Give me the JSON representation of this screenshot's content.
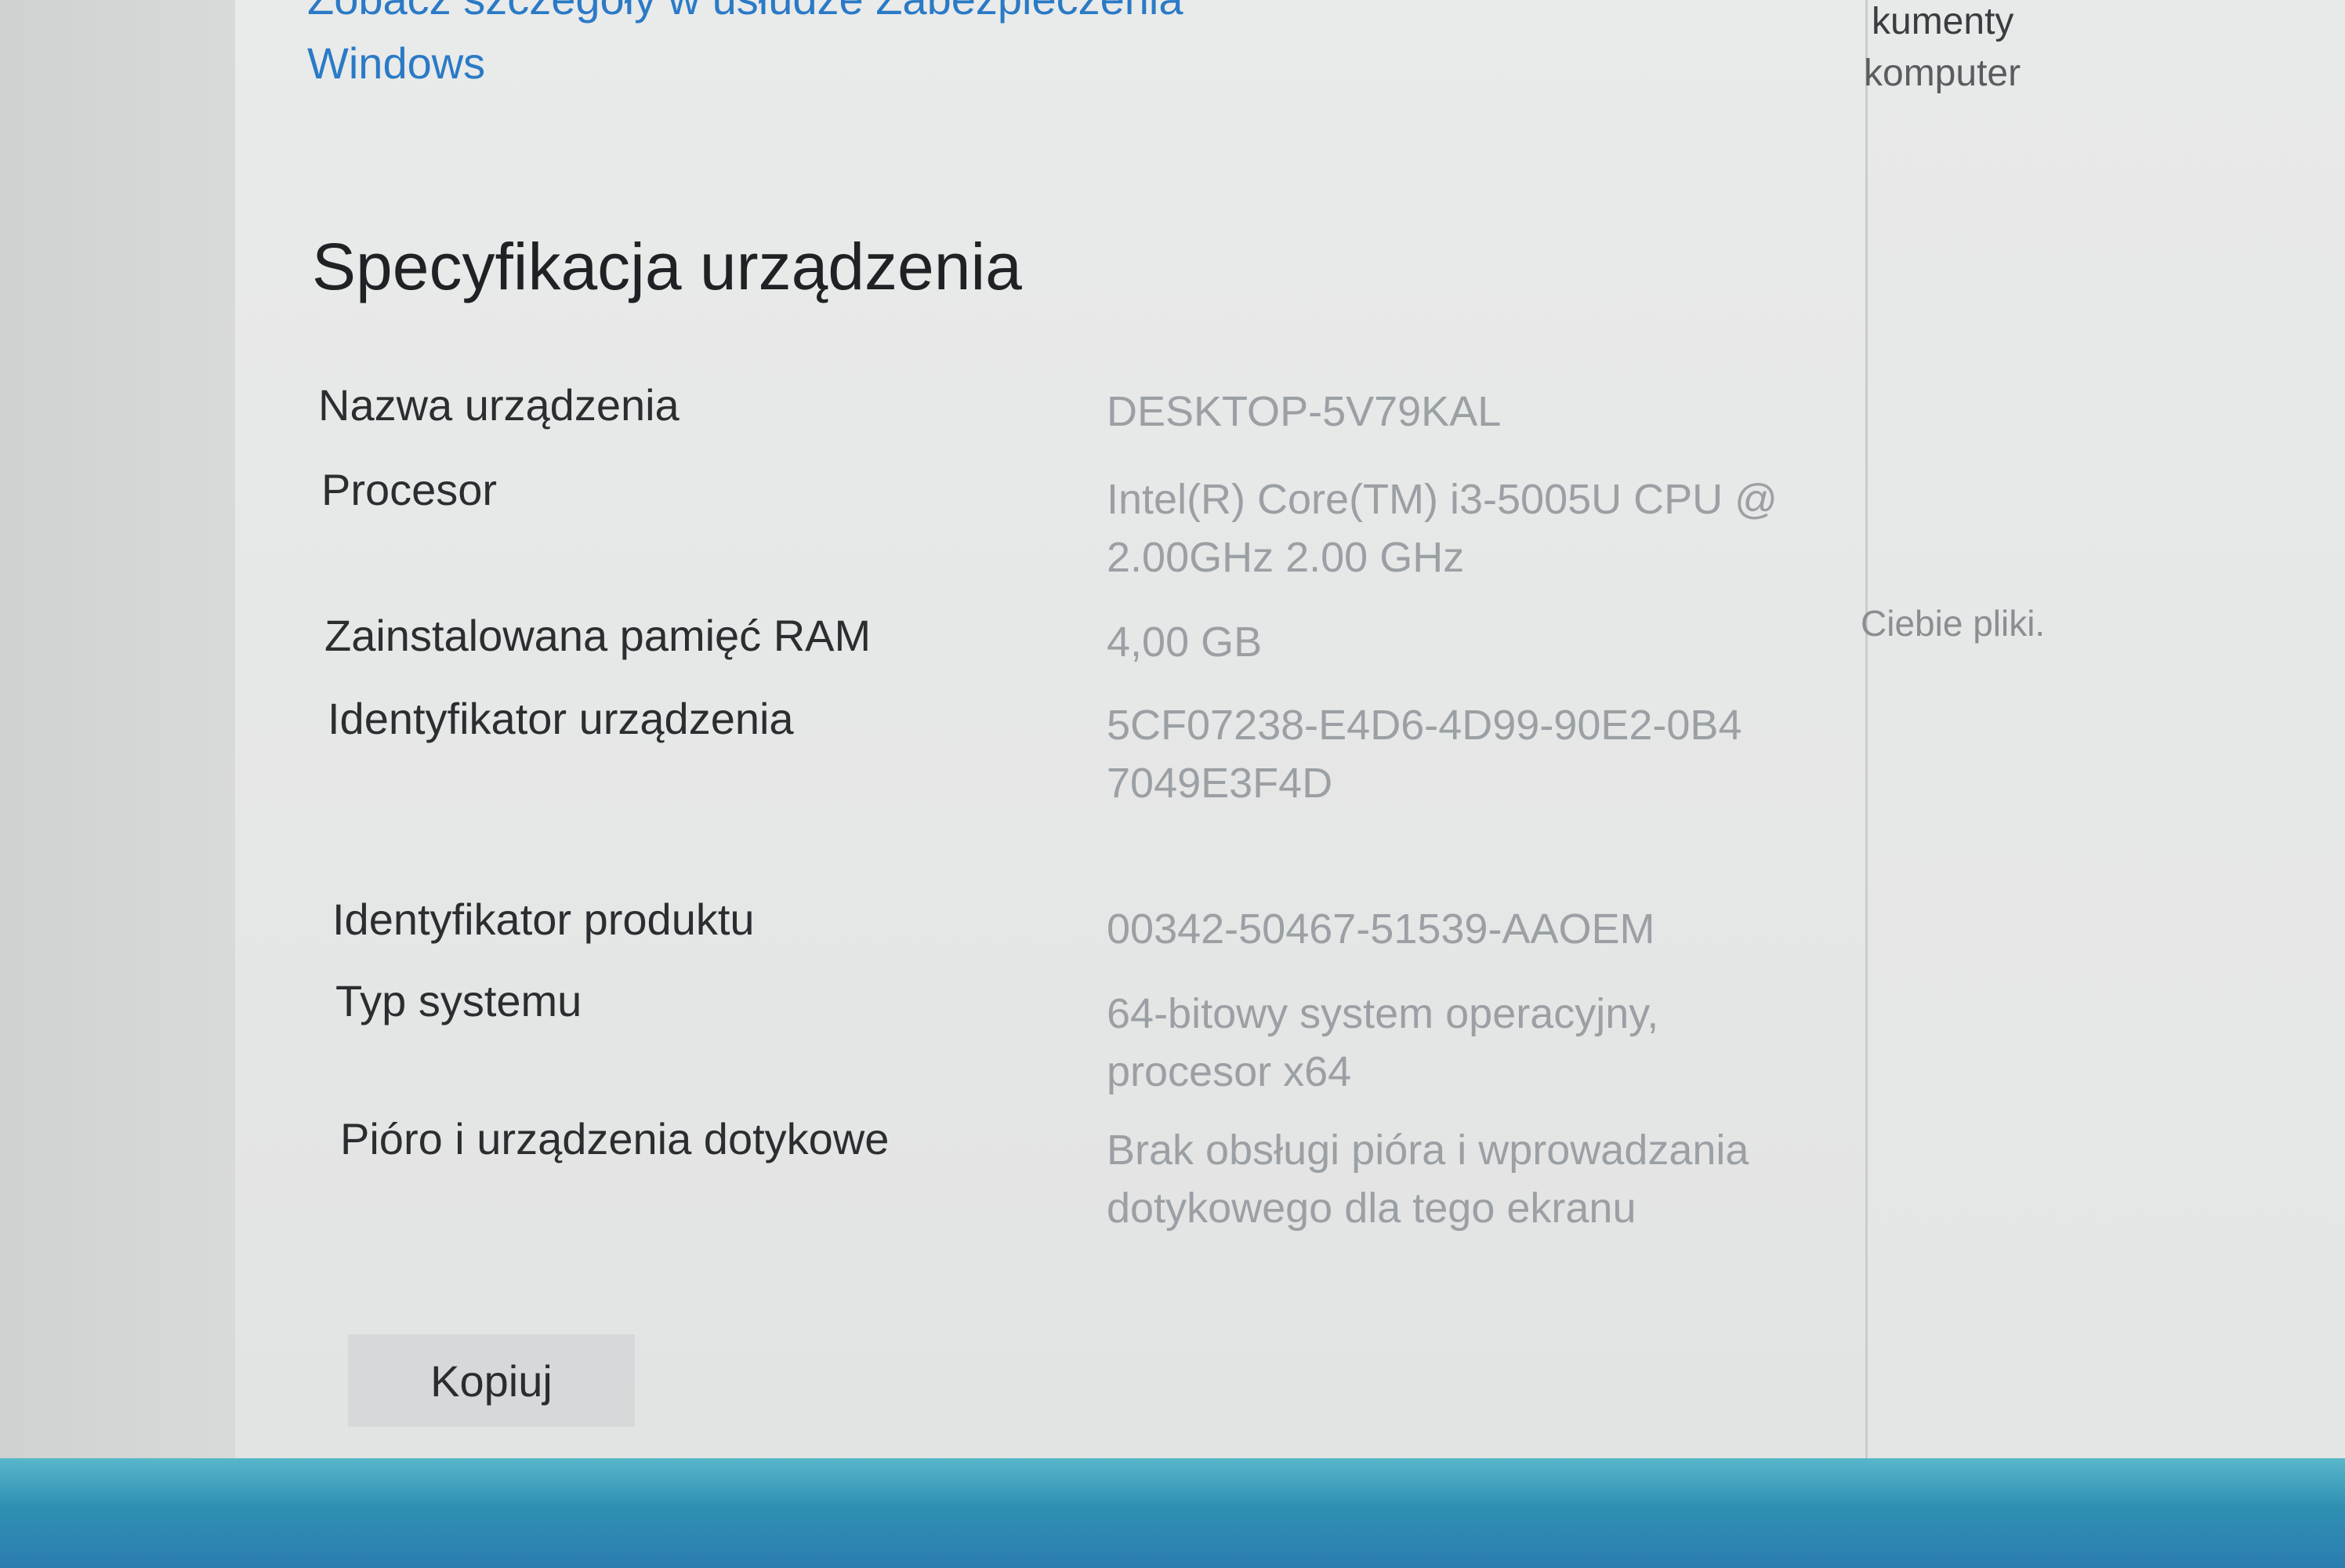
{
  "header_links": {
    "security_line": "Zobacz szczegóły w usłudze Zabezpieczenia",
    "security_line2": "Windows"
  },
  "right_panel": {
    "line1": "kumenty",
    "line2": "komputer",
    "line3": "Ciebie pliki."
  },
  "section": {
    "title": "Specyfikacja urządzenia"
  },
  "specs": [
    {
      "label": "Nazwa urządzenia",
      "value": "DESKTOP-5V79KAL"
    },
    {
      "label": "Procesor",
      "value": "Intel(R) Core(TM) i3-5005U CPU @ 2.00GHz   2.00 GHz"
    },
    {
      "label": "Zainstalowana pamięć RAM",
      "value": "4,00 GB"
    },
    {
      "label": "Identyfikator urządzenia",
      "value": "5CF07238-E4D6-4D99-90E2-0B47049E3F4D"
    },
    {
      "label": "Identyfikator produktu",
      "value": "00342-50467-51539-AAOEM"
    },
    {
      "label": "Typ systemu",
      "value": "64-bitowy system operacyjny, procesor x64"
    },
    {
      "label": "Pióro i urządzenia dotykowe",
      "value": "Brak obsługi pióra i wprowadzania dotykowego dla tego ekranu"
    }
  ],
  "actions": {
    "copy_label": "Kopiuj"
  },
  "colors": {
    "link": "#2a7ac6",
    "taskbar": "#2f8fb3"
  }
}
